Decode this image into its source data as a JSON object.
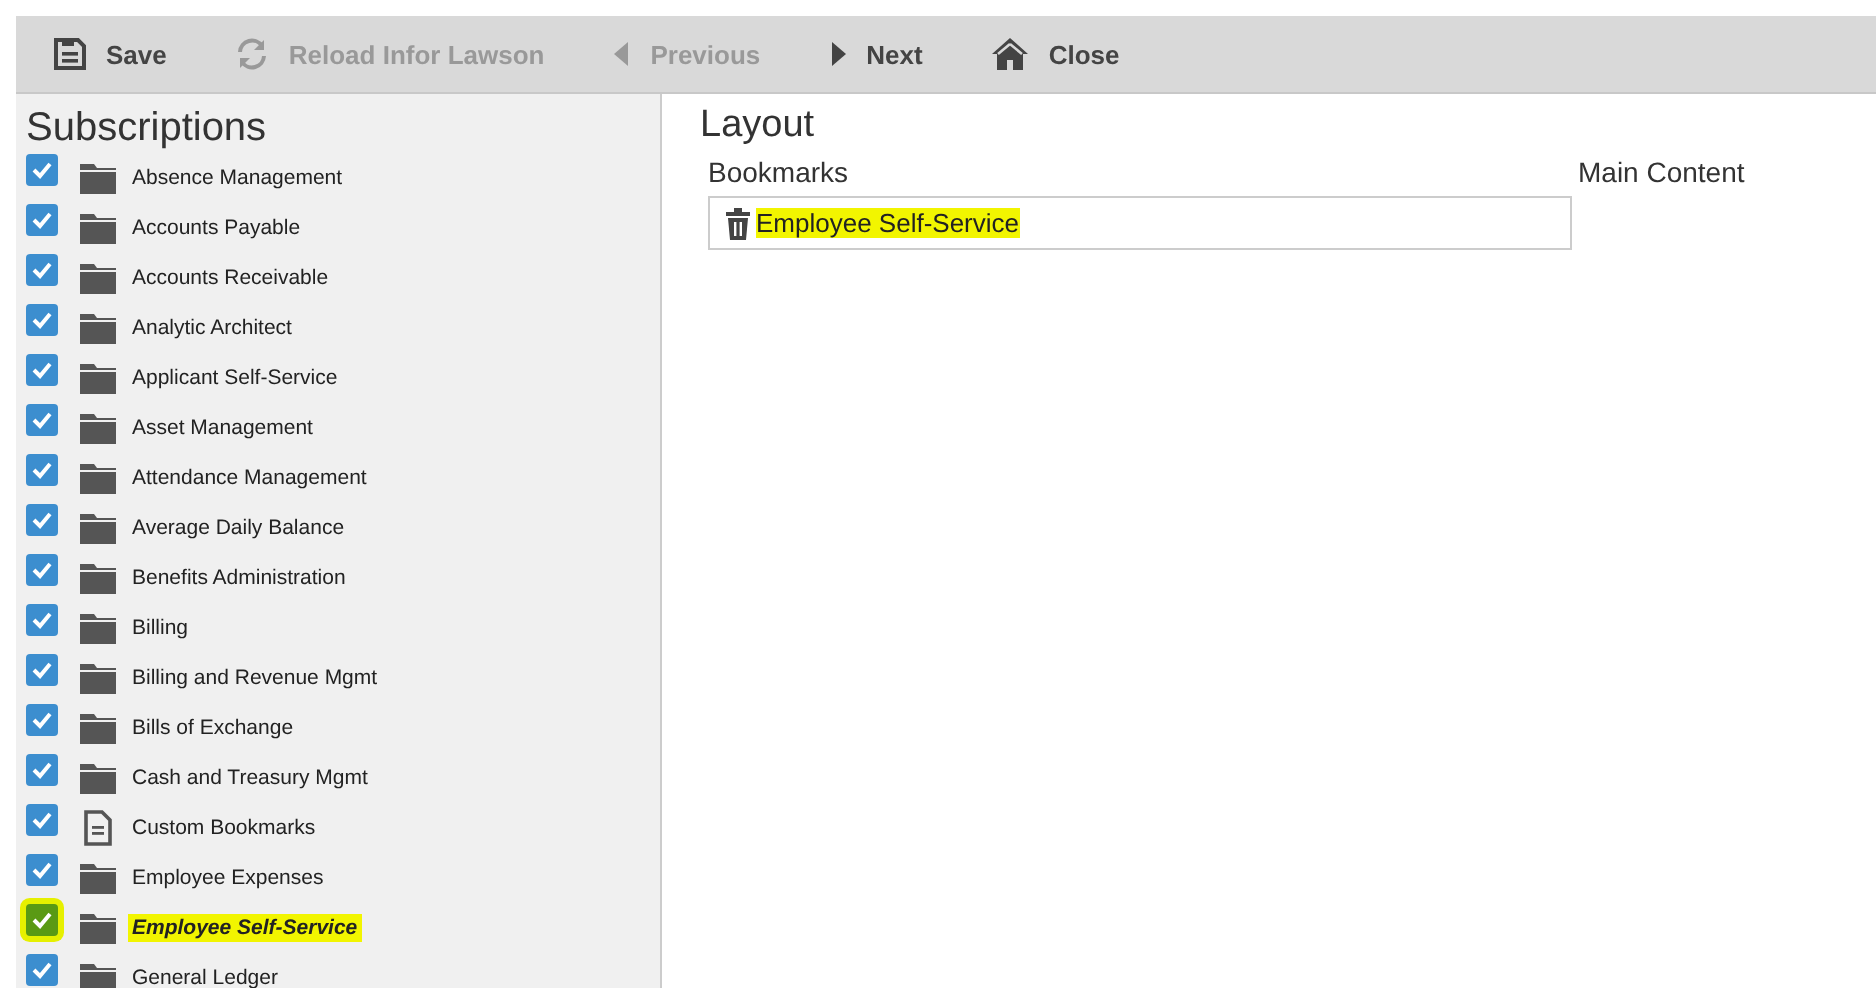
{
  "toolbar": [
    {
      "label": "Save",
      "kind": "save",
      "disabled": false
    },
    {
      "label": "Reload Infor Lawson",
      "kind": "reload",
      "disabled": true
    },
    {
      "label": "Previous",
      "kind": "previous",
      "disabled": true
    },
    {
      "label": "Next",
      "kind": "next",
      "disabled": false
    },
    {
      "label": "Close",
      "kind": "home",
      "disabled": false
    }
  ],
  "subscriptions": {
    "title": "Subscriptions",
    "items": [
      {
        "label": "Absence Management",
        "kind": "folder",
        "checked": true,
        "selected": false,
        "highlighted": false
      },
      {
        "label": "Accounts Payable",
        "kind": "folder",
        "checked": true,
        "selected": false,
        "highlighted": false
      },
      {
        "label": "Accounts Receivable",
        "kind": "folder",
        "checked": true,
        "selected": false,
        "highlighted": false
      },
      {
        "label": "Analytic Architect",
        "kind": "folder",
        "checked": true,
        "selected": false,
        "highlighted": false
      },
      {
        "label": "Applicant Self-Service",
        "kind": "folder",
        "checked": true,
        "selected": false,
        "highlighted": false
      },
      {
        "label": "Asset Management",
        "kind": "folder",
        "checked": true,
        "selected": false,
        "highlighted": false
      },
      {
        "label": "Attendance Management",
        "kind": "folder",
        "checked": true,
        "selected": false,
        "highlighted": false
      },
      {
        "label": "Average Daily Balance",
        "kind": "folder",
        "checked": true,
        "selected": false,
        "highlighted": false
      },
      {
        "label": "Benefits Administration",
        "kind": "folder",
        "checked": true,
        "selected": false,
        "highlighted": false
      },
      {
        "label": "Billing",
        "kind": "folder",
        "checked": true,
        "selected": false,
        "highlighted": false
      },
      {
        "label": "Billing and Revenue Mgmt",
        "kind": "folder",
        "checked": true,
        "selected": false,
        "highlighted": false
      },
      {
        "label": "Bills of Exchange",
        "kind": "folder",
        "checked": true,
        "selected": false,
        "highlighted": false
      },
      {
        "label": "Cash and Treasury Mgmt",
        "kind": "folder",
        "checked": true,
        "selected": false,
        "highlighted": false
      },
      {
        "label": "Custom Bookmarks",
        "kind": "document",
        "checked": true,
        "selected": false,
        "highlighted": false
      },
      {
        "label": "Employee Expenses",
        "kind": "folder",
        "checked": true,
        "selected": false,
        "highlighted": false
      },
      {
        "label": "Employee Self-Service",
        "kind": "folder",
        "checked": true,
        "selected": true,
        "highlighted": true
      },
      {
        "label": "General Ledger",
        "kind": "folder",
        "checked": true,
        "selected": false,
        "highlighted": false
      }
    ]
  },
  "layout": {
    "title": "Layout",
    "bookmarks": {
      "label": "Bookmarks",
      "items": [
        {
          "label": "Employee Self-Service",
          "highlighted": true
        }
      ]
    },
    "main_content": {
      "label": "Main Content"
    }
  }
}
